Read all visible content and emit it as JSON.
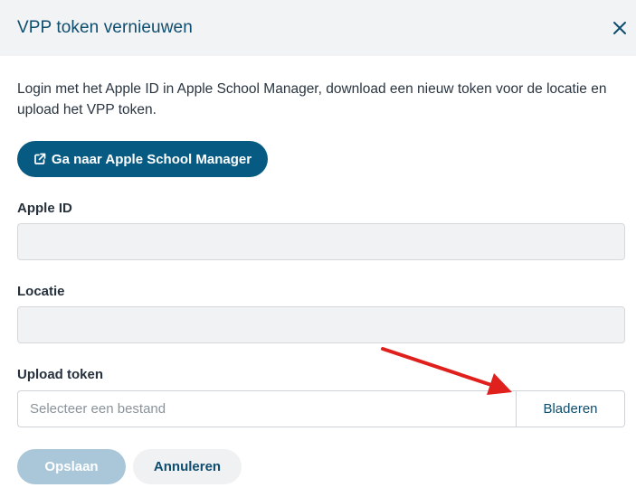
{
  "modal": {
    "title": "VPP token vernieuwen",
    "close_icon": "close-icon"
  },
  "intro": {
    "text": "Login met het Apple ID in Apple School Manager, download een nieuw token voor de locatie en upload het VPP token."
  },
  "apple_school_manager_button": {
    "label": "Ga naar Apple School Manager",
    "icon": "external-link-icon"
  },
  "fields": {
    "apple_id": {
      "label": "Apple ID",
      "value": ""
    },
    "locatie": {
      "label": "Locatie",
      "value": ""
    },
    "upload_token": {
      "label": "Upload token",
      "placeholder": "Selecteer een bestand",
      "browse_label": "Bladeren"
    }
  },
  "footer": {
    "save_label": "Opslaan",
    "cancel_label": "Annuleren"
  },
  "colors": {
    "primary": "#075a82",
    "primary_disabled": "#a9c7d9",
    "header_bg": "#f2f3f4",
    "title": "#0e4d6e",
    "annotation_arrow": "#e0201c"
  }
}
